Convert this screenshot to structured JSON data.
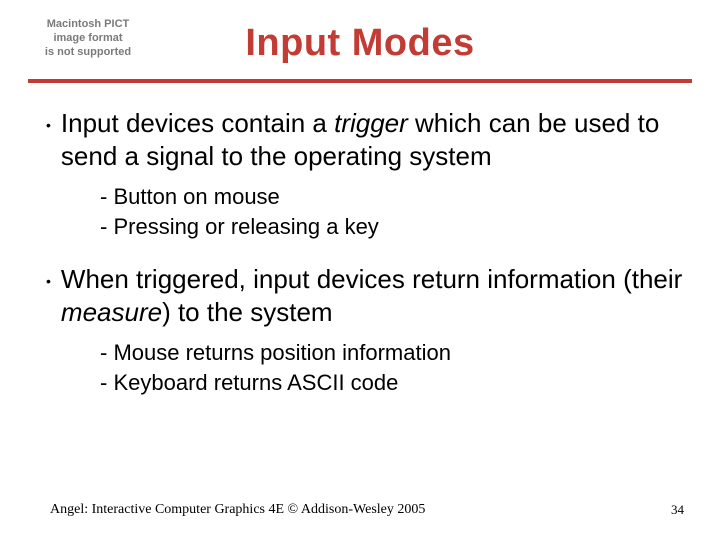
{
  "pict_placeholder": {
    "line1": "Macintosh PICT",
    "line2": "image format",
    "line3": "is not supported"
  },
  "title": "Input Modes",
  "bullets": [
    {
      "pre": "Input devices contain a ",
      "em": "trigger",
      "post": " which can be used to send a signal to the operating system",
      "subs": [
        "Button on mouse",
        "Pressing or releasing a key"
      ]
    },
    {
      "pre": "When triggered, input devices return information (their ",
      "em": "measure",
      "post": ") to the system",
      "subs": [
        "Mouse returns position information",
        "Keyboard returns ASCII code"
      ]
    }
  ],
  "footer": {
    "left": "Angel: Interactive Computer Graphics 4E © Addison-Wesley 2005",
    "right": "34"
  }
}
